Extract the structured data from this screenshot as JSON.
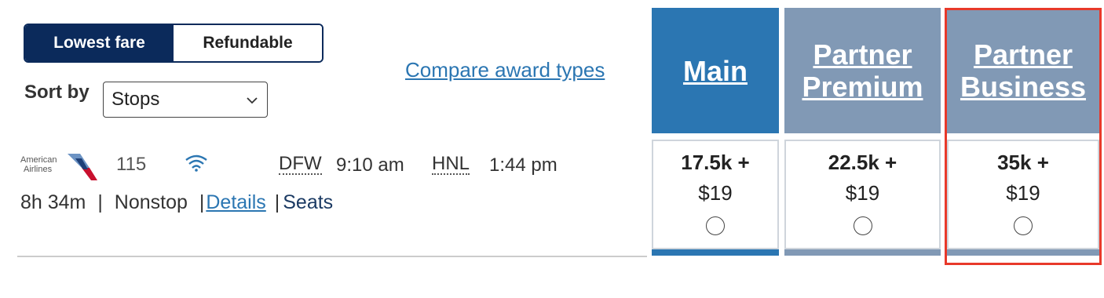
{
  "fare_toggle": {
    "lowest_label": "Lowest fare",
    "refundable_label": "Refundable"
  },
  "sort": {
    "label": "Sort by",
    "selected": "Stops"
  },
  "compare_link": "Compare award types",
  "flight": {
    "airline_logo_text": [
      "American",
      "Airlines"
    ],
    "flight_number": "115",
    "departure_code": "DFW",
    "departure_time": "9:10 am",
    "arrival_code": "HNL",
    "arrival_time": "1:44 pm",
    "duration": "8h 34m",
    "sep1": "|",
    "stops": "Nonstop",
    "sep2": "|",
    "details_label": "Details",
    "sep3": "|",
    "seats_label": "Seats"
  },
  "fare_columns": [
    {
      "title_line1": "Main",
      "title_line2": "",
      "miles": "17.5k +",
      "price": "$19"
    },
    {
      "title_line1": "Partner",
      "title_line2": "Premium",
      "miles": "22.5k +",
      "price": "$19"
    },
    {
      "title_line1": "Partner",
      "title_line2": "Business",
      "miles": "35k +",
      "price": "$19"
    }
  ],
  "colors": {
    "navy": "#0b2a5b",
    "main_blue": "#2b76b2",
    "partner_gray_blue": "#8199b5",
    "highlight_red": "#e8392a"
  }
}
